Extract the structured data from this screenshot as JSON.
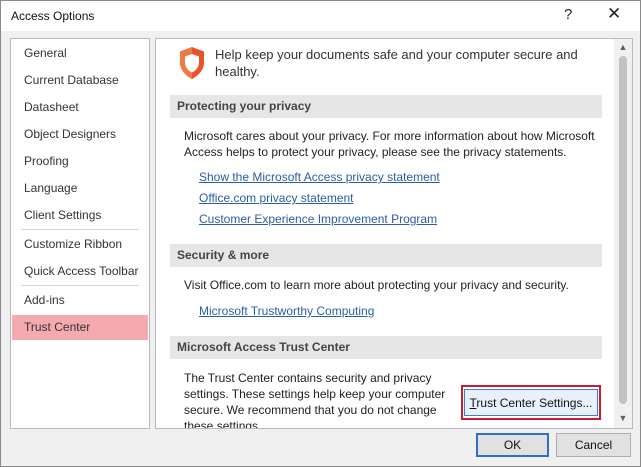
{
  "window": {
    "title": "Access Options",
    "help_glyph": "?",
    "close_glyph": "✕"
  },
  "sidebar": {
    "items": [
      {
        "label": "General",
        "selected": false
      },
      {
        "label": "Current Database",
        "selected": false
      },
      {
        "label": "Datasheet",
        "selected": false
      },
      {
        "label": "Object Designers",
        "selected": false
      },
      {
        "label": "Proofing",
        "selected": false
      },
      {
        "label": "Language",
        "selected": false
      },
      {
        "label": "Client Settings",
        "selected": false
      },
      {
        "label": "Customize Ribbon",
        "selected": false
      },
      {
        "label": "Quick Access Toolbar",
        "selected": false
      },
      {
        "label": "Add-ins",
        "selected": false
      },
      {
        "label": "Trust Center",
        "selected": true
      }
    ]
  },
  "content": {
    "intro": "Help keep your documents safe and your computer secure and healthy.",
    "privacy": {
      "heading": "Protecting your privacy",
      "text": "Microsoft cares about your privacy. For more information about how Microsoft Access helps to protect your privacy, please see the privacy statements.",
      "links": [
        "Show the Microsoft Access privacy statement",
        "Office.com privacy statement",
        "Customer Experience Improvement Program"
      ]
    },
    "security": {
      "heading": "Security & more",
      "text": "Visit Office.com to learn more about protecting your privacy and security.",
      "links": [
        "Microsoft Trustworthy Computing"
      ]
    },
    "trust_center": {
      "heading": "Microsoft Access Trust Center",
      "text": "The Trust Center contains security and privacy settings. These settings help keep your computer secure. We recommend that you do not change these settings.",
      "button_accel": "T",
      "button_rest": "rust Center Settings..."
    }
  },
  "footer": {
    "ok_label": "OK",
    "cancel_label": "Cancel"
  },
  "colors": {
    "selected_nav": "#f5aab0",
    "highlight_border": "#cc1b2e",
    "link": "#2a5ea5",
    "shield": "#e8532a"
  },
  "icons": {
    "shield": "shield-icon",
    "scroll_up": "chevron-up-icon",
    "scroll_down": "chevron-down-icon"
  }
}
